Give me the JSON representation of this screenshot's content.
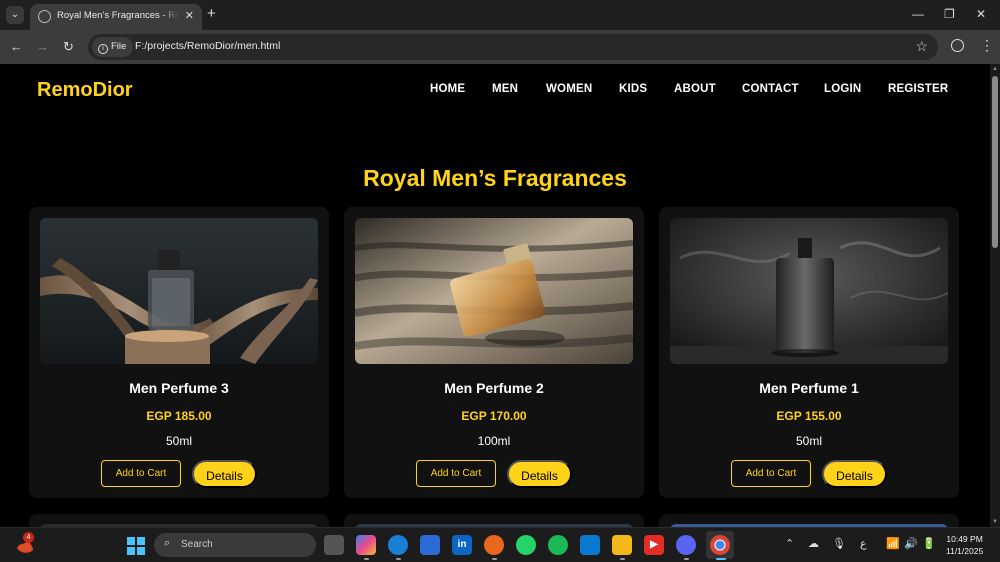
{
  "browser": {
    "tab_title": "Royal Men’s Fragrances - RemoDior",
    "new_tab": "+",
    "url_chip": "File",
    "url": "F:/projects/RemoDior/men.html"
  },
  "site": {
    "logo": "RemoDior",
    "nav": [
      "HOME",
      "MEN",
      "WOMEN",
      "KIDS",
      "ABOUT",
      "CONTACT",
      "LOGIN",
      "REGISTER"
    ],
    "page_title": "Royal Men’s Fragrances"
  },
  "products": [
    {
      "name": "Men Perfume 3",
      "price": "EGP 185.00",
      "size": "50ml",
      "cart_label": "Add to Cart",
      "details_label": "Details"
    },
    {
      "name": "Men Perfume 2",
      "price": "EGP 170.00",
      "size": "100ml",
      "cart_label": "Add to Cart",
      "details_label": "Details"
    },
    {
      "name": "Men Perfume 1",
      "price": "EGP 155.00",
      "size": "50ml",
      "cart_label": "Add to Cart",
      "details_label": "Details"
    }
  ],
  "taskbar": {
    "badge": "4",
    "search_placeholder": "Search",
    "time": "10:49 PM",
    "date": "11/1/2025",
    "lang": "ع"
  },
  "colors": {
    "accent": "#ffd31a",
    "page_bg": "#000000",
    "card_bg": "#111111"
  }
}
